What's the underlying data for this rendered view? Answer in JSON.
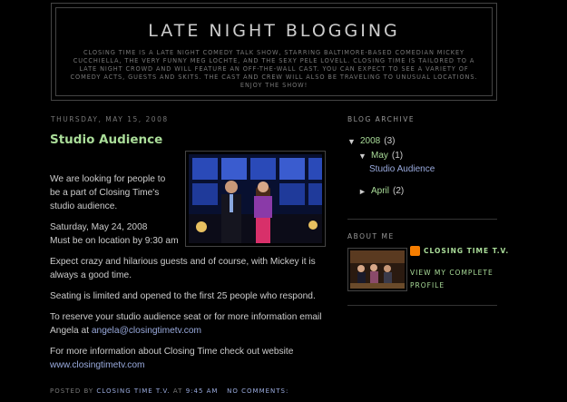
{
  "header": {
    "title": "LATE NIGHT BLOGGING",
    "description": "Closing Time is a late night comedy talk show, starring Baltimore-based comedian Mickey Cucchiella, the very funny Meg Lochte, and the sexy Pele Lovell. Closing Time is tailored to a late night crowd and will feature an off-the-wall cast. You can expect to see a variety of comedy acts, guests and skits. The cast and crew will also be traveling to unusual locations. Enjoy the show!"
  },
  "post": {
    "date": "Thursday, May 15, 2008",
    "title": "Studio Audience",
    "p1": "We are looking for people to be a part of Closing Time's studio audience.",
    "p2_line1": "Saturday, May 24, 2008",
    "p2_line2": "Must be on location by 9:30 am",
    "p3": "Expect crazy and hilarious guests and of course, with Mickey it is always a good time.",
    "p4": "Seating is limited and opened to the first 25 people who respond.",
    "p5": "To reserve your studio audience seat or for more information email Angela at ",
    "p5_link": "angela@closingtimetv.com",
    "p6": "For more information about Closing Time check out website",
    "p6_link": "www.closingtimetv.com",
    "footer_posted_by": "Posted by",
    "footer_author": "Closing Time T.V.",
    "footer_at": "at",
    "footer_time": "9:45 AM",
    "footer_comments": "No comments:"
  },
  "sidebar": {
    "archive_heading": "Blog Archive",
    "archive": {
      "year": "2008",
      "year_count": "(3)",
      "month": "May",
      "month_count": "(1)",
      "post": "Studio Audience",
      "month2": "April",
      "month2_count": "(2)",
      "expanded_toggle": "▼",
      "collapsed_toggle": "►"
    },
    "about_heading": "About Me",
    "profile_name": "Closing Time T.V.",
    "profile_link": "View my complete profile"
  },
  "colors": {
    "background": "#000000",
    "title_green": "#aadd99",
    "link_blue": "#99aadd",
    "blogger_orange": "#f57d00"
  }
}
